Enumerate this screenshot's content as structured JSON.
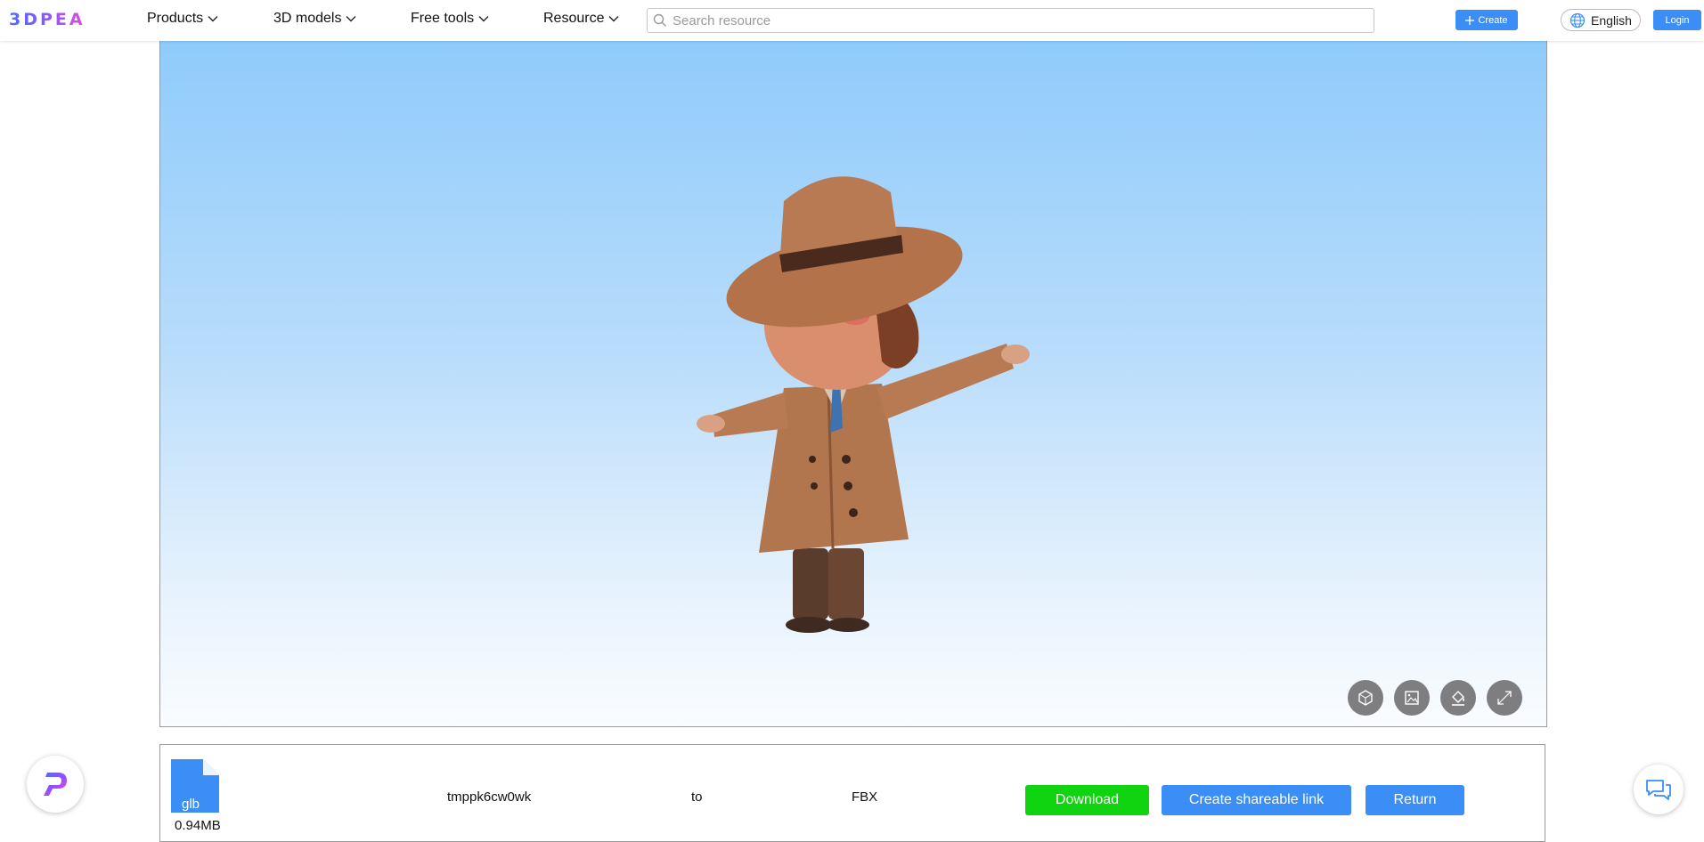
{
  "header": {
    "logo_text": "3DPEA",
    "nav": [
      {
        "label": "Products",
        "icon": "chevron-down-icon"
      },
      {
        "label": "3D models",
        "icon": "chevron-down-icon"
      },
      {
        "label": "Free tools",
        "icon": "chevron-down-icon"
      },
      {
        "label": "Resource",
        "icon": "chevron-down-icon"
      }
    ],
    "search_placeholder": "Search resource",
    "create_label": "Create",
    "language_label": "English",
    "login_label": "Login"
  },
  "viewer": {
    "tools": [
      "wireframe-icon",
      "background-image-icon",
      "paint-bucket-icon",
      "fullscreen-icon"
    ]
  },
  "conversion": {
    "file_ext": "glb",
    "file_size": "0.94MB",
    "file_name": "tmppk6cw0wk",
    "connector": "to",
    "target_format": "FBX",
    "download_label": "Download",
    "share_label": "Create shareable link",
    "return_label": "Return"
  },
  "colors": {
    "accent": "#3a8ef6",
    "download": "#10d410",
    "file_icon": "#3a8ef6"
  }
}
